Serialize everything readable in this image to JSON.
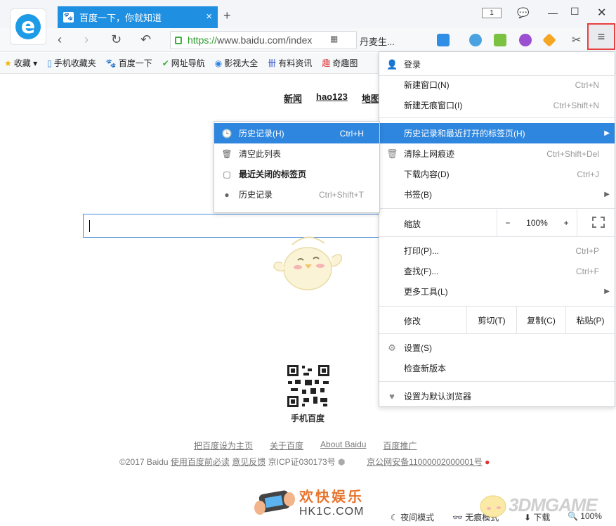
{
  "tab": {
    "title": "百度一下，你就知道",
    "close": "×",
    "new_tab": "+"
  },
  "window": {
    "tab_count": "1"
  },
  "navbar": {
    "url_https": "https://",
    "url_rest": "www.baidu.com/index",
    "search_chip": "丹麦生..."
  },
  "bookmarks": [
    {
      "icon": "★",
      "label": "收藏 ▾"
    },
    {
      "icon": "▯",
      "label": "手机收藏夹"
    },
    {
      "icon": "🐾",
      "label": "百度一下"
    },
    {
      "icon": "✔",
      "label": "网址导航"
    },
    {
      "icon": "◉",
      "label": "影视大全"
    },
    {
      "icon": "卌",
      "label": "有料资讯"
    },
    {
      "icon": "趣",
      "label": "奇趣图"
    }
  ],
  "page": {
    "toplinks": [
      "新闻",
      "hao123",
      "地图"
    ],
    "qr_label": "手机百度",
    "footer_links": [
      "把百度设为主页",
      "关于百度",
      "About Baidu",
      "百度推广"
    ],
    "copyright_a": "©2017 Baidu ",
    "copyright_b": "使用百度前必读",
    "copyright_c": " ",
    "copyright_d": "意见反馈",
    "copyright_e": " 京ICP证030173号 ",
    "copyright_f": "京公网安备11000002000001号"
  },
  "status": {
    "night": "夜间模式",
    "noimg": "无痕模式",
    "download": "下载",
    "zoom": "100%"
  },
  "watermark": {
    "line1": "欢快娱乐",
    "line2": "HK1C.COM",
    "brand": "3DMGAME"
  },
  "menu": {
    "login": "登录",
    "new_window": "新建窗口(N)",
    "new_window_sc": "Ctrl+N",
    "new_incognito": "新建无痕窗口(I)",
    "new_incognito_sc": "Ctrl+Shift+N",
    "history": "历史记录和最近打开的标签页(H)",
    "clear": "清除上网痕迹",
    "clear_sc": "Ctrl+Shift+Del",
    "downloads": "下载内容(D)",
    "downloads_sc": "Ctrl+J",
    "bookmarks": "书签(B)",
    "zoom": "缩放",
    "zoom_minus": "−",
    "zoom_value": "100%",
    "zoom_plus": "+",
    "print": "打印(P)...",
    "print_sc": "Ctrl+P",
    "find": "查找(F)...",
    "find_sc": "Ctrl+F",
    "more_tools": "更多工具(L)",
    "edit": "修改",
    "cut": "剪切(T)",
    "copy": "复制(C)",
    "paste": "粘贴(P)",
    "settings": "设置(S)",
    "check_update": "检查新版本",
    "default_browser": "设置为默认浏览器"
  },
  "submenu": {
    "history": "历史记录(H)",
    "history_sc": "Ctrl+H",
    "clear_list": "清空此列表",
    "recent_closed": "最近关闭的标签页",
    "history2": "历史记录",
    "history2_sc": "Ctrl+Shift+T"
  }
}
